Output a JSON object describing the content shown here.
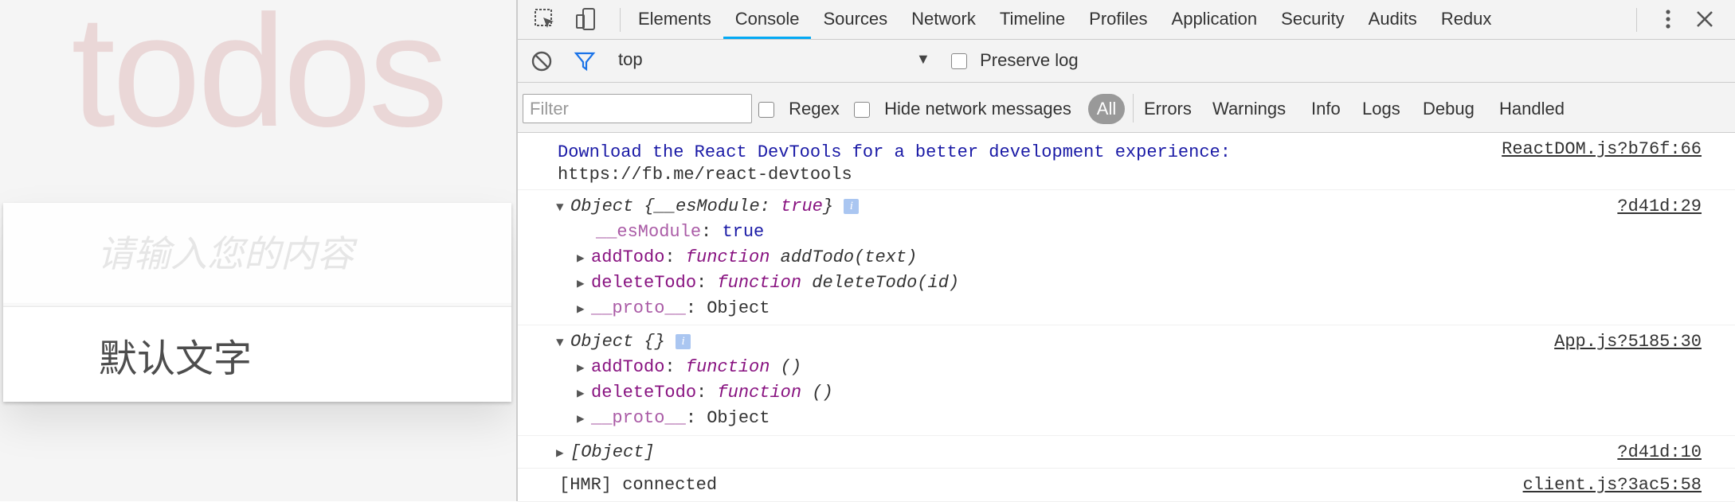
{
  "app": {
    "title": "todos",
    "input_placeholder": "请输入您的内容",
    "todo_text": "默认文字"
  },
  "devtools": {
    "tabs": [
      "Elements",
      "Console",
      "Sources",
      "Network",
      "Timeline",
      "Profiles",
      "Application",
      "Security",
      "Audits",
      "Redux"
    ],
    "active_tab": "Console",
    "context": "top",
    "preserve_log": "Preserve log",
    "filter_placeholder": "Filter",
    "regex": "Regex",
    "hide_network": "Hide network messages",
    "levels": [
      "All",
      "Errors",
      "Warnings",
      "Info",
      "Logs",
      "Debug",
      "Handled"
    ],
    "accent": "#03a9f4"
  },
  "console": {
    "m1": {
      "line1": "Download the React DevTools for a better development experience:",
      "line2": "https://fb.me/react-devtools",
      "source": "ReactDOM.js?b76f:66"
    },
    "m2": {
      "header_pre": "Object {",
      "header_key": "__esModule",
      "header_mid": ": ",
      "header_val": "true",
      "header_post": "}",
      "source": "?d41d:29",
      "p1_key": "__esModule",
      "p1_val": "true",
      "p2_key": "addTodo",
      "p2_fn": "function",
      "p2_sig": "addTodo(text)",
      "p3_key": "deleteTodo",
      "p3_fn": "function",
      "p3_sig": "deleteTodo(id)",
      "p4_key": "__proto__",
      "p4_val": "Object"
    },
    "m3": {
      "header": "Object {}",
      "source": "App.js?5185:30",
      "p1_key": "addTodo",
      "p1_fn": "function",
      "p1_sig": "()",
      "p2_key": "deleteTodo",
      "p2_fn": "function",
      "p2_sig": "()",
      "p3_key": "__proto__",
      "p3_val": "Object"
    },
    "m4": {
      "text": "[Object]",
      "source": "?d41d:10"
    },
    "m5": {
      "text": "[HMR] connected",
      "source": "client.js?3ac5:58"
    },
    "info_glyph": "i",
    "colon": ": "
  }
}
